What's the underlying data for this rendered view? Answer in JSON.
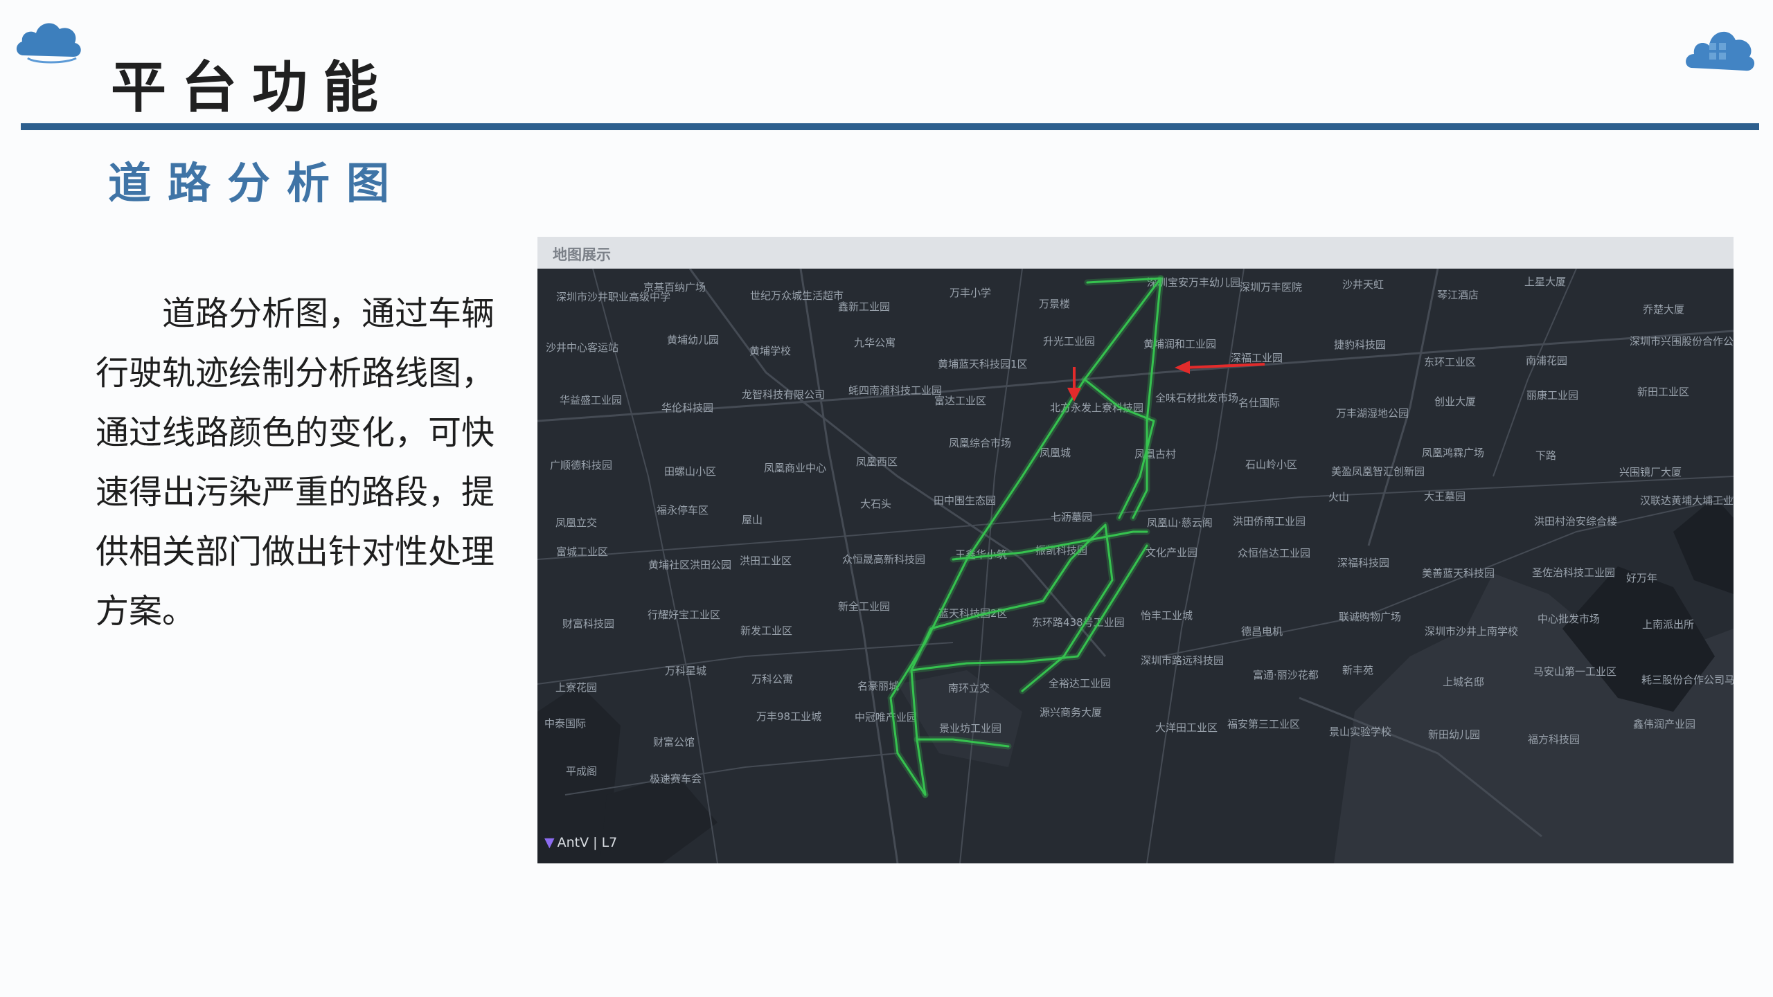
{
  "header": {
    "title": "平台功能",
    "subtitle": "道路分析图",
    "logo_icon": "cloud-logo-icon"
  },
  "description": "道路分析图，通过车辆行驶轨迹绘制分析路线图，通过线路颜色的变化，可快速得出污染严重的路段，提供相关部门做出针对性处理方案。",
  "map": {
    "header_label": "地图展示",
    "attribution": "AntV | L7",
    "route_color": "#36c24f",
    "marker_color": "#e32b2b",
    "labels": [
      "深圳市沙井职业高级中学",
      "京基百纳广场",
      "世纪万众城生活超市",
      "鑫新工业园",
      "万丰小学",
      "万景楼",
      "深圳宝安万丰幼儿园",
      "深圳万丰医院",
      "沙井天虹",
      "琴江酒店",
      "上星大厦",
      "乔楚大厦",
      "沙井中心客运站",
      "黄埔幼儿园",
      "黄埔学校",
      "九华公寓",
      "黄埔蓝天科技园1区",
      "升光工业园",
      "黄埔润和工业园",
      "深福工业园",
      "捷豹科技园",
      "东环工业区",
      "南浦花园",
      "深圳市兴围股份合作公司第三工业园",
      "华益盛工业园",
      "华伦科技园",
      "龙智科技有限公司",
      "蚝四南浦科技工业园",
      "富达工业区",
      "北方永发上寮科技园",
      "全味石材批发市场",
      "名仕国际",
      "万丰湖湿地公园",
      "创业大厦",
      "丽康工业园",
      "新田工业区",
      "广顺德科技园",
      "田螺山小区",
      "凤凰商业中心",
      "凤凰西区",
      "凤凰综合市场",
      "凤凰城",
      "凤凰古村",
      "石山岭小区",
      "美盈凤凰智汇创新园",
      "凤凰鸿霖广场",
      "下路",
      "兴围镜厂大厦",
      "凤凰立交",
      "福永停车区",
      "屋山",
      "大石头",
      "田中围生态园",
      "七沥墓园",
      "凤凰山·慈云阁",
      "洪田侨南工业园",
      "火山",
      "大王墓园",
      "洪田村治安综合楼",
      "汉联达黄埔大埔工业区",
      "富城工业区",
      "黄埔社区洪田公园",
      "洪田工业区",
      "众恒晟高新科技园",
      "王鑫华小筑",
      "振凯科技园",
      "文化产业园",
      "众恒信达工业园",
      "深福科技园",
      "美善蓝天科技园",
      "圣佐治科技工业园",
      "好万年",
      "财富科技园",
      "行耀好宝工业区",
      "新发工业区",
      "新全工业园",
      "蓝天科技园2区",
      "东环路438号工业园",
      "怡丰工业城",
      "德昌电机",
      "联诚购物广场",
      "深圳市沙井上南学校",
      "中心批发市场",
      "上南派出所",
      "上寮花园",
      "万科星城",
      "万科公寓",
      "名豪丽城",
      "南环立交",
      "全裕达工业园",
      "深圳市路远科技园",
      "富通·丽沙花都",
      "新丰苑",
      "上城名邸",
      "马安山第一工业区",
      "耗三股份合作公司马安山工业园",
      "中泰国际",
      "财富公馆",
      "万丰98工业城",
      "中冠唯产业园",
      "景业坊工业园",
      "源兴商务大厦",
      "大洋田工业区",
      "福安第三工业区",
      "景山实验学校",
      "新田幼儿园",
      "福方科技园",
      "鑫伟润产业园",
      "平成阁",
      "极速赛车会"
    ]
  }
}
